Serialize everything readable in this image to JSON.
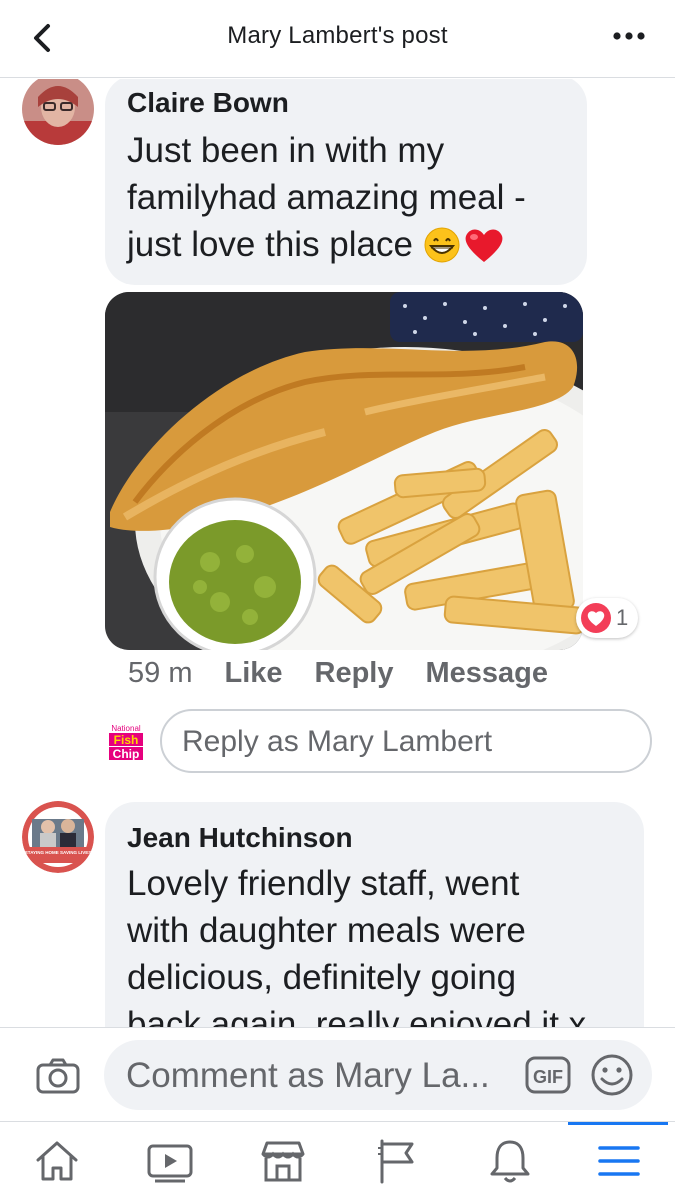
{
  "header": {
    "title": "Mary Lambert's post"
  },
  "comments": [
    {
      "author": "Claire Bown",
      "lines": [
        "Just been in with my",
        "familyhad amazing meal -",
        "just love this place"
      ],
      "emoji": [
        "😁",
        "❤️"
      ],
      "reactions": {
        "count": "1"
      },
      "time": "59 m",
      "actions": {
        "like": "Like",
        "reply": "Reply",
        "message": "Message"
      }
    },
    {
      "author": "Jean Hutchinson",
      "lines": [
        "Lovely friendly staff, went",
        "with daughter meals were",
        "delicious, definitely going",
        "back again, really enjoyed it x"
      ],
      "avatar_badge": "STAYING HOME SAVING LIVES"
    }
  ],
  "reply_box": {
    "placeholder": "Reply as Mary Lambert",
    "page_logo_text": [
      "National",
      "Fish",
      "Chip"
    ]
  },
  "comment_bar": {
    "placeholder": "Comment as Mary La...",
    "gif_label": "GIF"
  },
  "colors": {
    "accent": "#1877f2",
    "bubble": "#f0f2f5",
    "secondary_text": "#65676b",
    "heart": "#f33e58"
  },
  "tabbar": {
    "items": [
      "home-icon",
      "watch-icon",
      "marketplace-icon",
      "pages-flag-icon",
      "notifications-bell-icon",
      "menu-icon"
    ],
    "active": "menu-icon"
  }
}
